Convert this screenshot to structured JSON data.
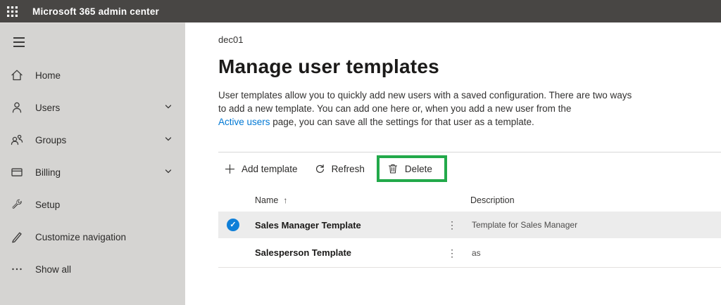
{
  "topbar": {
    "title": "Microsoft 365 admin center"
  },
  "sidebar": {
    "items": [
      {
        "label": "Home"
      },
      {
        "label": "Users"
      },
      {
        "label": "Groups"
      },
      {
        "label": "Billing"
      },
      {
        "label": "Setup"
      },
      {
        "label": "Customize navigation"
      },
      {
        "label": "Show all"
      }
    ]
  },
  "main": {
    "breadcrumb": "dec01",
    "title": "Manage user templates",
    "description": {
      "line1": "User templates allow you to quickly add new users with a saved configuration. There are two ways",
      "line2": "to add a new template. You can add one here or, when you add a new user from the",
      "link": "Active users",
      "line3_rest": " page, you can save all the settings for that user as a template."
    },
    "toolbar": {
      "add_label": "Add template",
      "refresh_label": "Refresh",
      "delete_label": "Delete"
    },
    "table": {
      "columns": {
        "name": "Name",
        "description": "Description"
      },
      "sort_arrow": "↑",
      "ellipsis_glyph": "⋮",
      "check_glyph": "✓",
      "rows": [
        {
          "name": "Sales Manager Template",
          "description": "Template for Sales Manager"
        },
        {
          "name": "Salesperson Template",
          "description": "as"
        }
      ]
    }
  },
  "colors": {
    "topbar_bg": "#484644",
    "sidebar_bg": "#d5d4d2",
    "accent_blue": "#0078d4",
    "selected_row_bg": "#ececec",
    "highlight_green": "#22a94a",
    "check_circle_blue": "#0f7fd8"
  }
}
